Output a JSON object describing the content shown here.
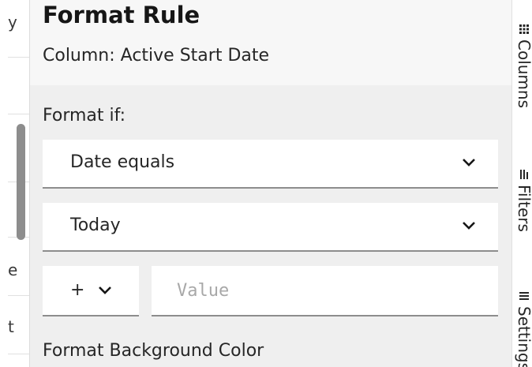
{
  "left_strip": {
    "fragments": [
      "y",
      "e",
      "t"
    ]
  },
  "panel": {
    "title": "Format Rule",
    "column_caption": "Column: Active Start Date",
    "format_if_label": "Format if:",
    "condition_select": {
      "value": "Date equals",
      "icon": "chevron-down-icon"
    },
    "date_select": {
      "value": "Today",
      "icon": "chevron-down-icon"
    },
    "operator_select": {
      "value": "+",
      "icon": "chevron-down-icon"
    },
    "value_input": {
      "placeholder": "Value",
      "value": ""
    },
    "background_color_label": "Format Background Color"
  },
  "right_rail": {
    "tabs": [
      {
        "label": "Columns",
        "icon": "grid-icon"
      },
      {
        "label": "Filters",
        "icon": "filter-icon"
      },
      {
        "label": "Settings",
        "icon": "menu-icon"
      }
    ]
  },
  "colors": {
    "panel_background": "#efefef",
    "header_background": "#f7f7f7",
    "field_background": "#ffffff",
    "field_border": "#8d8d8d",
    "text": "#161616",
    "placeholder": "#a8a8a8",
    "scrollbar": "#8d8d8d"
  }
}
